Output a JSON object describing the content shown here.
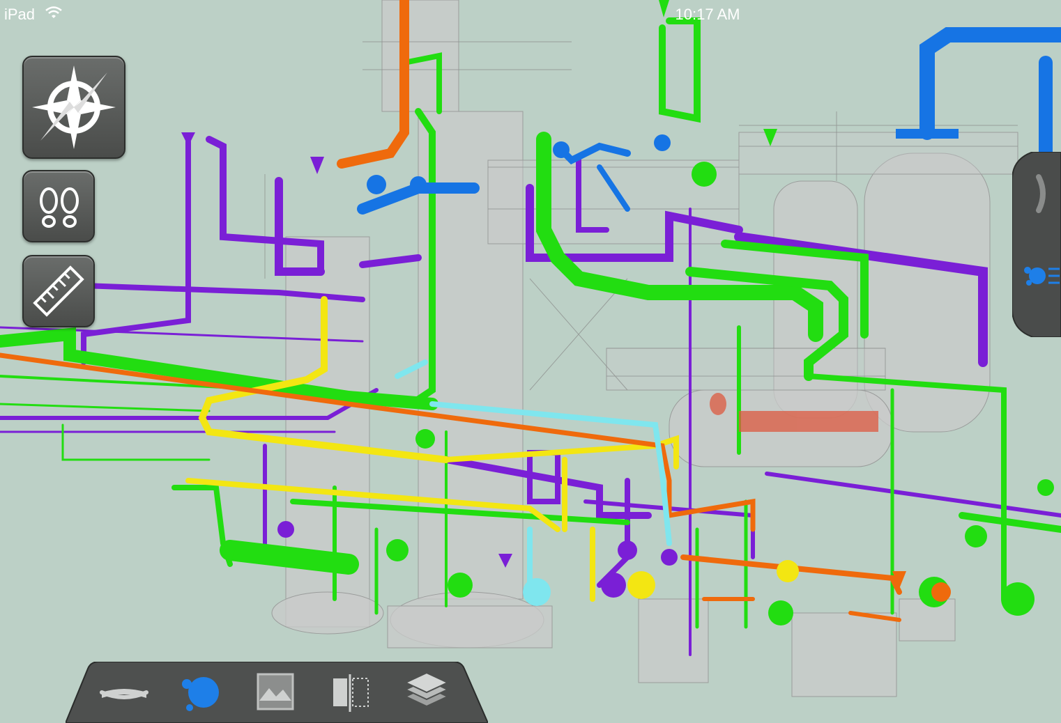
{
  "status_bar": {
    "carrier": "iPad",
    "time": "10:17 AM"
  },
  "left_tools": [
    {
      "name": "navigation-compass",
      "icon": "compass-icon"
    },
    {
      "name": "walk-mode",
      "icon": "footprints-icon"
    },
    {
      "name": "measure",
      "icon": "ruler-icon"
    }
  ],
  "bottom_toolbar": [
    {
      "name": "view-mode",
      "icon": "surface-icon"
    },
    {
      "name": "appearance",
      "icon": "bubbles-icon",
      "active_color": "#1e7fe8"
    },
    {
      "name": "section-box",
      "icon": "section-icon"
    },
    {
      "name": "section-plane",
      "icon": "plane-cut-icon"
    },
    {
      "name": "layers",
      "icon": "layers-icon"
    }
  ],
  "side_panel": {
    "icon": "bubbles-list-icon",
    "accent": "#1e7fe8"
  },
  "pipe_colors": {
    "green": "#22dd11",
    "purple": "#7a1fd6",
    "yellow": "#f3e612",
    "orange": "#ef6a0c",
    "blue": "#1674e4",
    "cyan": "#7fe6ee",
    "red": "#dd5a40"
  },
  "background": "#bcd0c6"
}
